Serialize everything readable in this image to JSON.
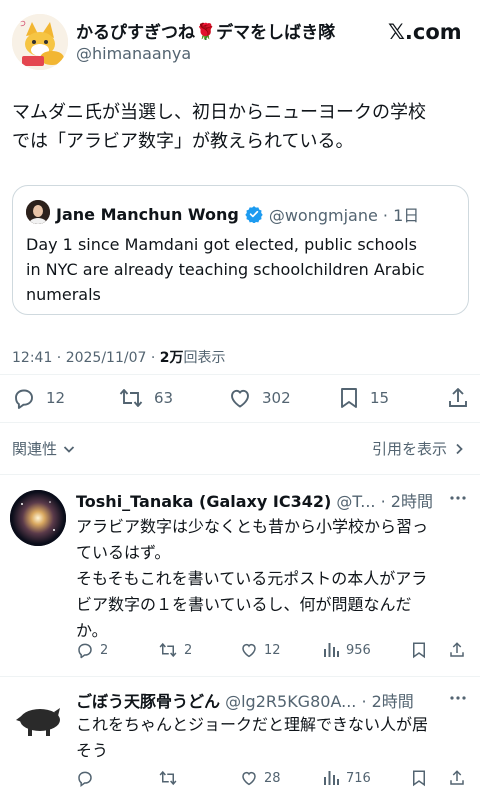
{
  "author": {
    "display_name": "かるぴすぎつね🌹デマをしばき隊",
    "handle": "@himanaanya",
    "avatar_icon": "fox-avatar-icon"
  },
  "brand": {
    "label": "𝕏.com"
  },
  "post": {
    "text_line1": "マムダニ氏が当選し、初日からニューヨークの学校",
    "text_line2": "では「アラビア数字」が教えられている。"
  },
  "quote": {
    "display_name": "Jane Manchun Wong",
    "handle_time": "@wongmjane · 1日",
    "line1": "Day 1 since Mamdani got elected, public schools",
    "line2": "in NYC are already teaching schoolchildren Arabic",
    "line3": "numerals"
  },
  "meta": {
    "timestamp": "12:41 · 2025/11/07 · ",
    "views_count": "2万",
    "views_label": "回表示"
  },
  "actions": {
    "replies": "12",
    "reposts": "63",
    "likes": "302",
    "bookmarks": "15"
  },
  "sort": {
    "left_label": "関連性",
    "right_label": "引用を表示"
  },
  "replies": [
    {
      "name": "Toshi_Tanaka (Galaxy IC342)",
      "handle_time": "@T... · 2時間",
      "lines": [
        "アラビア数字は少なくとも昔から小学校から習っ",
        "ているはず。",
        "そもそもこれを書いている元ポストの本人がアラ",
        "ビア数字の１を書いているし、何が問題なんだ",
        "か。"
      ],
      "replies": "2",
      "reposts": "2",
      "likes": "12",
      "views": "956"
    },
    {
      "name": "ごぼう天豚骨うどん",
      "handle_time": "@lg2R5KG80A... · 2時間",
      "lines": [
        "これをちゃんとジョークだと理解できない人が居",
        "そう"
      ],
      "replies": "",
      "reposts": "",
      "likes": "28",
      "views": "716"
    }
  ],
  "colors": {
    "verified": "#1d9bf0",
    "text": "#0f1419",
    "muted": "#536471",
    "divider": "#eff3f4"
  }
}
